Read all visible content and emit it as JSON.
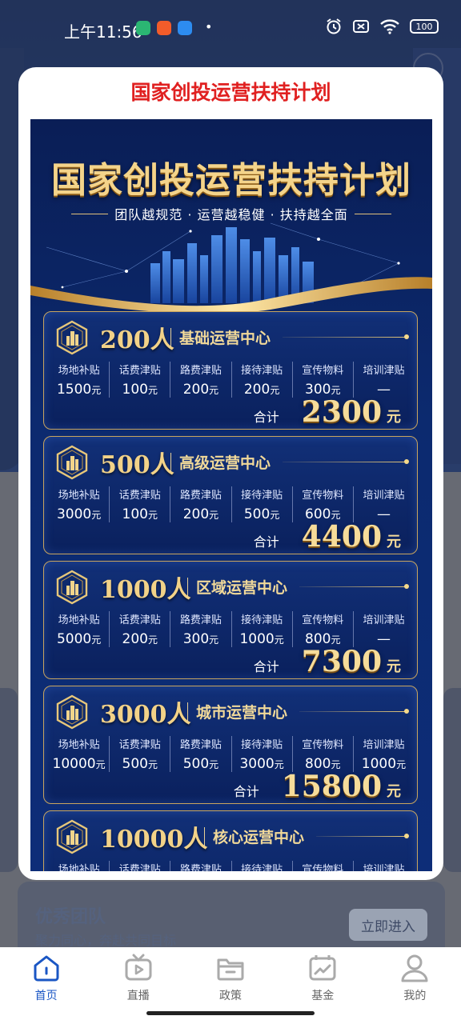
{
  "status_bar": {
    "time": "上午11:56",
    "battery": "100"
  },
  "background": {
    "team_card": {
      "title": "优秀团队",
      "subtitle": "聚力同心，奔赴共同目标",
      "button": "立即进入"
    }
  },
  "modal": {
    "title": "国家创投运营扶持计划"
  },
  "poster": {
    "headline": "国家创投运营扶持计划",
    "slogan": "团队越规范 · 运营越稳健 · 扶持越全面",
    "total_label": "合计",
    "currency": "元",
    "tiers": [
      {
        "count": "200人",
        "name": "基础运营中心",
        "items": [
          {
            "label": "场地补贴",
            "value": "1500",
            "unit": "元"
          },
          {
            "label": "话费津贴",
            "value": "100",
            "unit": "元"
          },
          {
            "label": "路费津贴",
            "value": "200",
            "unit": "元"
          },
          {
            "label": "接待津贴",
            "value": "200",
            "unit": "元"
          },
          {
            "label": "宣传物料",
            "value": "300",
            "unit": "元"
          },
          {
            "label": "培训津贴",
            "value": "—",
            "unit": ""
          }
        ],
        "total": "2300"
      },
      {
        "count": "500人",
        "name": "高级运营中心",
        "items": [
          {
            "label": "场地补贴",
            "value": "3000",
            "unit": "元"
          },
          {
            "label": "话费津贴",
            "value": "100",
            "unit": "元"
          },
          {
            "label": "路费津贴",
            "value": "200",
            "unit": "元"
          },
          {
            "label": "接待津贴",
            "value": "500",
            "unit": "元"
          },
          {
            "label": "宣传物料",
            "value": "600",
            "unit": "元"
          },
          {
            "label": "培训津贴",
            "value": "—",
            "unit": ""
          }
        ],
        "total": "4400"
      },
      {
        "count": "1000人",
        "name": "区域运营中心",
        "items": [
          {
            "label": "场地补贴",
            "value": "5000",
            "unit": "元"
          },
          {
            "label": "话费津贴",
            "value": "200",
            "unit": "元"
          },
          {
            "label": "路费津贴",
            "value": "300",
            "unit": "元"
          },
          {
            "label": "接待津贴",
            "value": "1000",
            "unit": "元"
          },
          {
            "label": "宣传物料",
            "value": "800",
            "unit": "元"
          },
          {
            "label": "培训津贴",
            "value": "—",
            "unit": ""
          }
        ],
        "total": "7300"
      },
      {
        "count": "3000人",
        "name": "城市运营中心",
        "items": [
          {
            "label": "场地补贴",
            "value": "10000",
            "unit": "元"
          },
          {
            "label": "话费津贴",
            "value": "500",
            "unit": "元"
          },
          {
            "label": "路费津贴",
            "value": "500",
            "unit": "元"
          },
          {
            "label": "接待津贴",
            "value": "3000",
            "unit": "元"
          },
          {
            "label": "宣传物料",
            "value": "800",
            "unit": "元"
          },
          {
            "label": "培训津贴",
            "value": "1000",
            "unit": "元"
          }
        ],
        "total": "15800"
      },
      {
        "count": "10000人",
        "name": "核心运营中心",
        "items": [
          {
            "label": "场地补贴",
            "value": "",
            "unit": ""
          },
          {
            "label": "话费津贴",
            "value": "",
            "unit": ""
          },
          {
            "label": "路费津贴",
            "value": "",
            "unit": ""
          },
          {
            "label": "接待津贴",
            "value": "",
            "unit": ""
          },
          {
            "label": "宣传物料",
            "value": "",
            "unit": ""
          },
          {
            "label": "培训津贴",
            "value": "",
            "unit": ""
          }
        ],
        "total": ""
      }
    ]
  },
  "tab_bar": {
    "tabs": [
      {
        "label": "首页",
        "icon": "home-icon",
        "active": true
      },
      {
        "label": "直播",
        "icon": "live-tv-icon",
        "active": false
      },
      {
        "label": "政策",
        "icon": "folder-icon",
        "active": false
      },
      {
        "label": "基金",
        "icon": "chart-board-icon",
        "active": false
      },
      {
        "label": "我的",
        "icon": "user-icon",
        "active": false
      }
    ]
  },
  "colors": {
    "modal_title": "#e02020",
    "gold": "#f2d288",
    "active_tab": "#1a56c4"
  }
}
